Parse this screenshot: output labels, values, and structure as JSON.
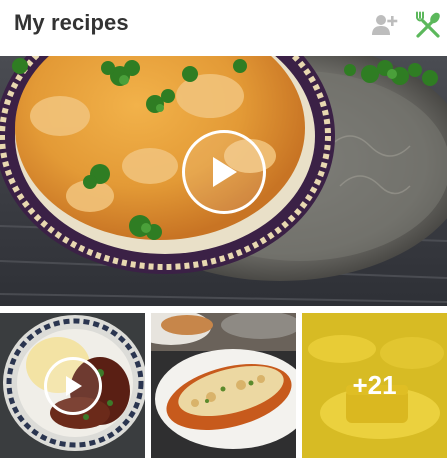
{
  "header": {
    "title": "My recipes",
    "add_user_icon": "add-person-icon",
    "recipes_icon": "fork-knife-icon",
    "recipes_icon_color": "#5cb85c",
    "add_user_icon_color": "#bdbdbd"
  },
  "hero": {
    "type": "video",
    "icon": "play-icon"
  },
  "thumbnails": [
    {
      "type": "video",
      "icon": "play-icon"
    },
    {
      "type": "photo"
    },
    {
      "type": "more",
      "count_label": "+21",
      "overlay_color": "#eccd1e"
    }
  ]
}
